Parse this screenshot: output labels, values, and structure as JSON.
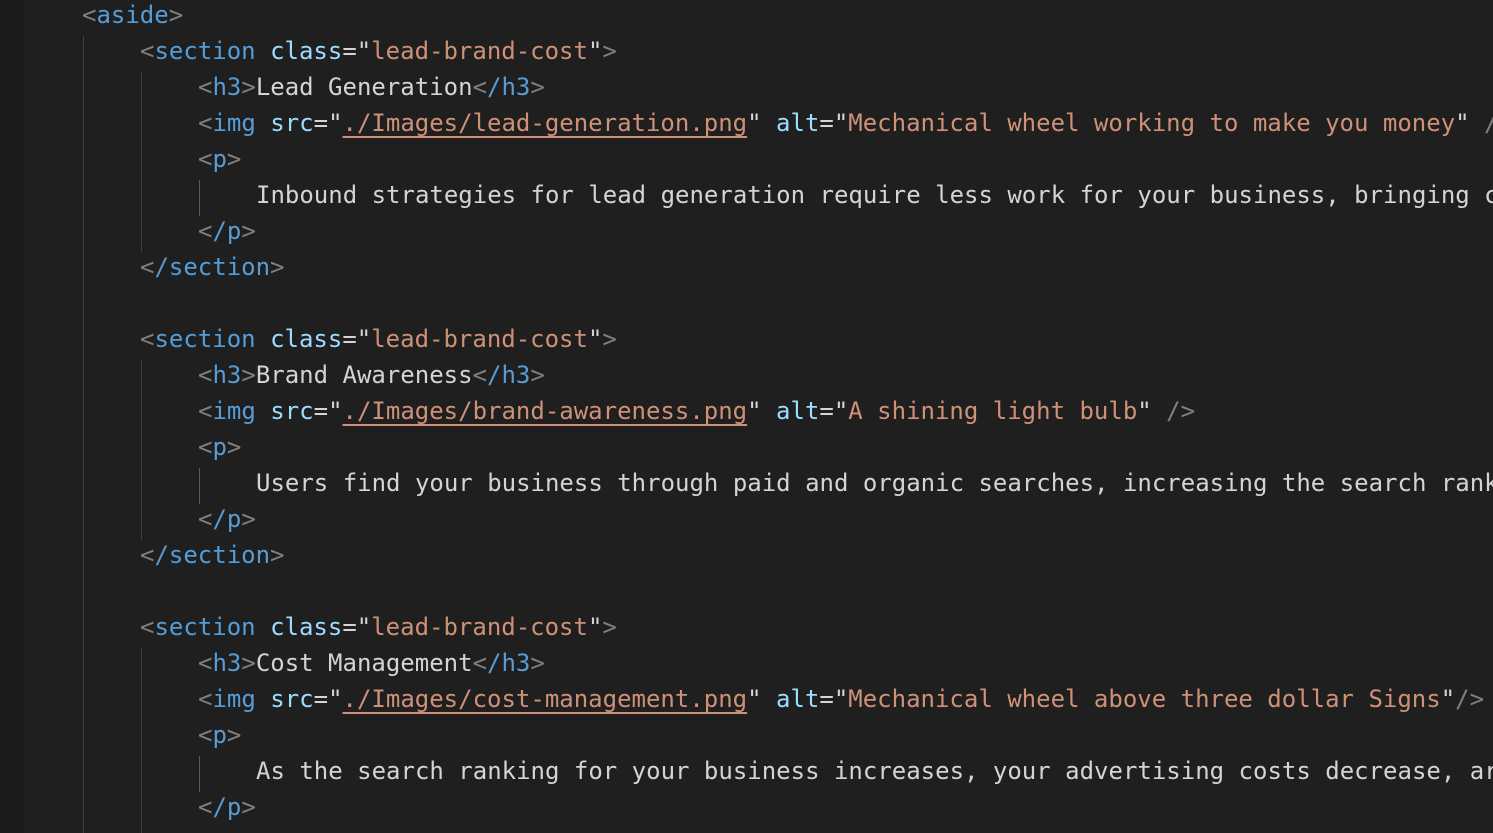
{
  "editor": {
    "lines": {
      "aside_open": {
        "tag": "aside"
      },
      "sections": [
        {
          "open": {
            "tag": "section",
            "attr": "class",
            "value": "lead-brand-cost"
          },
          "h3": {
            "tag": "h3",
            "text": "Lead Generation",
            "close": "/h3"
          },
          "img": {
            "tag": "img",
            "src_attr": "src",
            "src": "./Images/lead-generation.png",
            "alt_attr": "alt",
            "alt": "Mechanical wheel working to make you money",
            "tail": " /"
          },
          "p_open": "p",
          "p_text": "Inbound strategies for lead generation require less work for your business, bringing c",
          "p_close": "/p",
          "close": "/section"
        },
        {
          "open": {
            "tag": "section",
            "attr": "class",
            "value": "lead-brand-cost"
          },
          "h3": {
            "tag": "h3",
            "text": "Brand Awareness",
            "close": "/h3"
          },
          "img": {
            "tag": "img",
            "src_attr": "src",
            "src": "./Images/brand-awareness.png",
            "alt_attr": "alt",
            "alt": "A shining light bulb",
            "tail": " />"
          },
          "p_open": "p",
          "p_text": "Users find your business through paid and organic searches, increasing the search rank",
          "p_close": "/p",
          "close": "/section"
        },
        {
          "open": {
            "tag": "section",
            "attr": "class",
            "value": "lead-brand-cost"
          },
          "h3": {
            "tag": "h3",
            "text": "Cost Management",
            "close": "/h3"
          },
          "img": {
            "tag": "img",
            "src_attr": "src",
            "src": "./Images/cost-management.png",
            "alt_attr": "alt",
            "alt": "Mechanical wheel above three dollar Signs",
            "tail": "/>"
          },
          "p_open": "p",
          "p_text": "As the search ranking for your business increases, your advertising costs decrease, ar",
          "p_close": "/p"
        }
      ]
    },
    "syntax_colors": {
      "bracket": "#808080",
      "tag": "#569cd6",
      "attribute": "#9cdcfe",
      "string": "#ce9178",
      "text": "#d4d4d4",
      "background": "#1f1f1f"
    }
  }
}
